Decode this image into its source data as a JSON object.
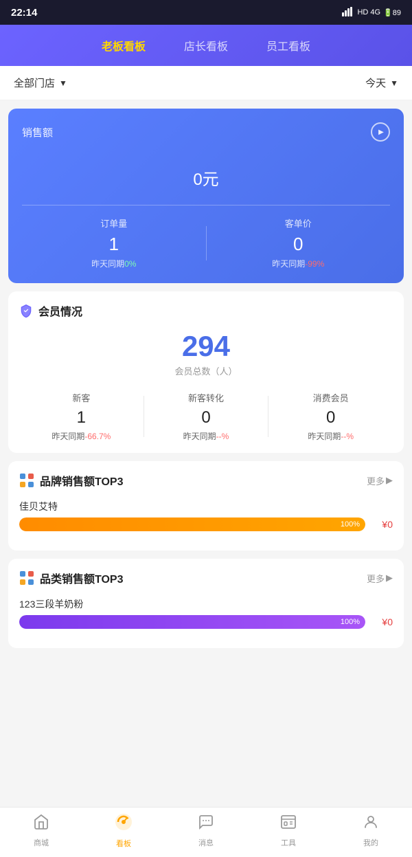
{
  "statusBar": {
    "time": "22:14",
    "signal": "HD 4G",
    "battery": "89"
  },
  "tabs": {
    "items": [
      {
        "id": "boss",
        "label": "老板看板",
        "active": true
      },
      {
        "id": "manager",
        "label": "店长看板",
        "active": false
      },
      {
        "id": "staff",
        "label": "员工看板",
        "active": false
      }
    ]
  },
  "filterBar": {
    "storeLabel": "全部门店",
    "timeLabel": "今天"
  },
  "salesCard": {
    "title": "销售额",
    "amount": "0",
    "unit": "元",
    "orderCount": {
      "label": "订单量",
      "value": "1",
      "compareLabel": "昨天同期",
      "comparePct": "0%",
      "isNegative": false
    },
    "avgPrice": {
      "label": "客单价",
      "value": "0",
      "compareLabel": "昨天同期",
      "comparePct": "-99%",
      "isNegative": true
    }
  },
  "memberSection": {
    "title": "会员情况",
    "totalCount": "294",
    "totalLabel": "会员总数（人）",
    "stats": [
      {
        "label": "新客",
        "value": "1",
        "compareLabel": "昨天同期",
        "comparePct": "-66.7%",
        "isNegative": true
      },
      {
        "label": "新客转化",
        "value": "0",
        "compareLabel": "昨天同期",
        "comparePct": "--%",
        "isNegative": true
      },
      {
        "label": "消费会员",
        "value": "0",
        "compareLabel": "昨天同期",
        "comparePct": "--%",
        "isNegative": true
      }
    ]
  },
  "brandTop3": {
    "title": "品牌销售额TOP3",
    "moreLabel": "更多",
    "items": [
      {
        "name": "佳贝艾特",
        "pct": 100,
        "pctLabel": "100%",
        "price": "¥0",
        "color": "orange"
      }
    ]
  },
  "categoryTop3": {
    "title": "品类销售额TOP3",
    "moreLabel": "更多",
    "items": [
      {
        "name": "123三段羊奶粉",
        "pct": 100,
        "pctLabel": "100%",
        "price": "¥0",
        "color": "purple"
      }
    ]
  },
  "bottomNav": {
    "items": [
      {
        "id": "shop",
        "label": "商城",
        "icon": "🏠",
        "active": false
      },
      {
        "id": "dashboard",
        "label": "看板",
        "icon": "📊",
        "active": true
      },
      {
        "id": "message",
        "label": "消息",
        "icon": "💬",
        "active": false
      },
      {
        "id": "tools",
        "label": "工具",
        "icon": "🧰",
        "active": false
      },
      {
        "id": "mine",
        "label": "我的",
        "icon": "👤",
        "active": false
      }
    ]
  }
}
